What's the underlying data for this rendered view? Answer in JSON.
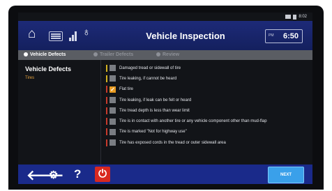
{
  "status_bar": {
    "time": "8:02"
  },
  "header": {
    "title": "Vehicle Inspection",
    "clock_ampm": "PM",
    "clock_time": "6:50"
  },
  "steps": [
    {
      "label": "Vehicle Defects",
      "active": true
    },
    {
      "label": "Trailer Defects",
      "active": false
    },
    {
      "label": "Review",
      "active": false
    }
  ],
  "sidebar": {
    "heading": "Vehicle Defects",
    "items": [
      {
        "label": "Tires"
      }
    ]
  },
  "defects": [
    {
      "label": "Damaged tread or sidewall of tire",
      "checked": false,
      "bar_color": "#d4b21f"
    },
    {
      "label": "Tire leaking, if cannot be heard",
      "checked": false,
      "bar_color": "#d4b21f"
    },
    {
      "label": "Flat tire",
      "checked": true,
      "bar_color": "#c83a2c"
    },
    {
      "label": "Tire leaking, if leak can be felt or heard",
      "checked": false,
      "bar_color": "#c83a2c"
    },
    {
      "label": "Tire tread depth is less than wear limit",
      "checked": false,
      "bar_color": "#c83a2c"
    },
    {
      "label": "Tire is in contact with another tire or any vehicle component other than mud-flap",
      "checked": false,
      "bar_color": "#c83a2c"
    },
    {
      "label": "Tire is marked \"Not for highway use\"",
      "checked": false,
      "bar_color": "#c83a2c"
    },
    {
      "label": "Tire has exposed cords in the tread or outer sidewall area",
      "checked": false,
      "bar_color": "#c83a2c"
    }
  ],
  "bottom_bar": {
    "next_label": "NEXT"
  },
  "icons": {
    "home": "home-icon",
    "keyboard": "keyboard-icon",
    "signal": "signal-icon",
    "bulb": "lightbulb-icon",
    "back": "arrow-left-icon",
    "settings": "gear-icon",
    "help": "question-icon",
    "power": "power-icon"
  },
  "colors": {
    "header": "#1d2a78",
    "accent": "#e89b23",
    "next": "#3aa0ea",
    "power": "#d9281f"
  }
}
